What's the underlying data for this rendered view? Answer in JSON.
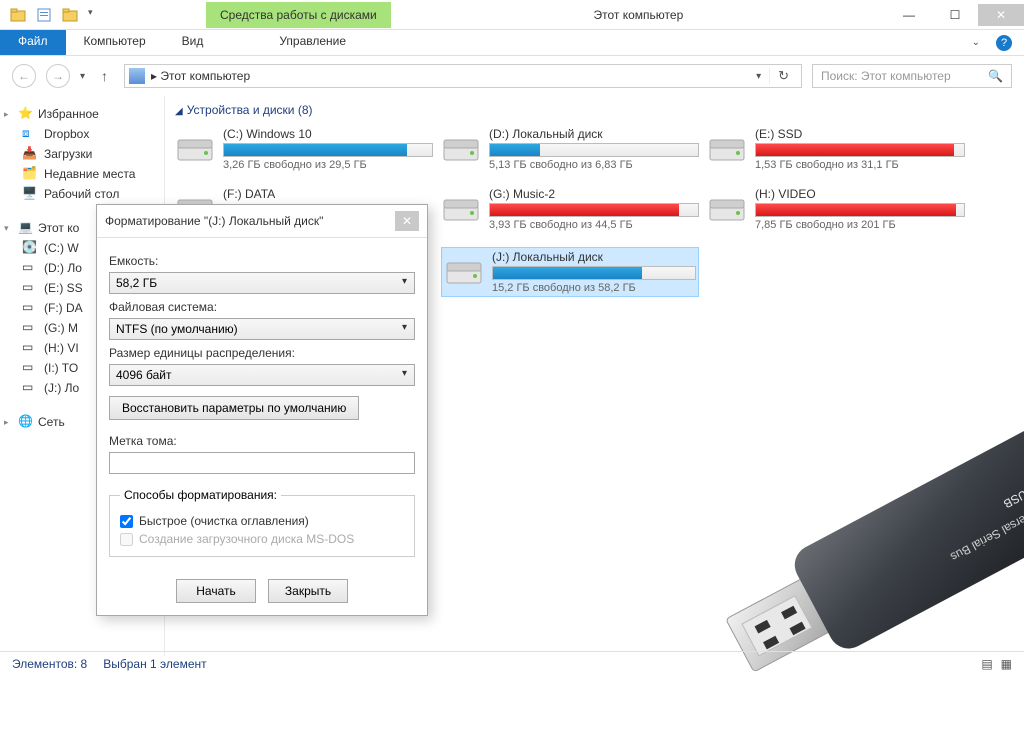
{
  "titlebar": {
    "context_tab": "Средства работы с дисками",
    "title": "Этот компьютер"
  },
  "ribbon": {
    "file": "Файл",
    "computer": "Компьютер",
    "view": "Вид",
    "manage": "Управление"
  },
  "nav": {
    "address": "Этот компьютер",
    "search_placeholder": "Поиск: Этот компьютер"
  },
  "sidebar": {
    "favorites": {
      "title": "Избранное",
      "items": [
        "Dropbox",
        "Загрузки",
        "Недавние места",
        "Рабочий стол"
      ]
    },
    "pc": {
      "title": "Этот ко",
      "items": [
        "(C:) W",
        "(D:) Ло",
        "(E:) SS",
        "(F:) DA",
        "(G:) M",
        "(H:) VI",
        "(I:) TO",
        "(J:) Ло"
      ]
    },
    "network": {
      "title": "Сеть"
    }
  },
  "main": {
    "section": "Устройства и диски (8)",
    "drives": [
      {
        "name": "(C:) Windows 10",
        "free": "3,26 ГБ свободно из 29,5 ГБ",
        "color": "blue",
        "pct": 88,
        "selected": false
      },
      {
        "name": "(D:) Локальный диск",
        "free": "5,13 ГБ свободно из 6,83 ГБ",
        "color": "blue",
        "pct": 24,
        "selected": false
      },
      {
        "name": "(E:) SSD",
        "free": "1,53 ГБ свободно из 31,1 ГБ",
        "color": "red",
        "pct": 95,
        "selected": false
      },
      {
        "name": "(F:) DATA",
        "free": "",
        "color": "",
        "pct": 0,
        "selected": false,
        "hidden": true
      },
      {
        "name": "(G:) Music-2",
        "free": "3,93 ГБ свободно из 44,5 ГБ",
        "color": "red",
        "pct": 91,
        "selected": false
      },
      {
        "name": "(H:) VIDEO",
        "free": "7,85 ГБ свободно из 201 ГБ",
        "color": "red",
        "pct": 96,
        "selected": false
      },
      {
        "name": "",
        "free": "",
        "color": "",
        "pct": 0,
        "selected": false,
        "hidden": true,
        "ghost": true
      },
      {
        "name": "(J:) Локальный диск",
        "free": "15,2 ГБ свободно из 58,2 ГБ",
        "color": "blue",
        "pct": 74,
        "selected": true
      }
    ]
  },
  "dialog": {
    "title": "Форматирование \"(J:) Локальный диск\"",
    "capacity_label": "Емкость:",
    "capacity_value": "58,2 ГБ",
    "fs_label": "Файловая система:",
    "fs_value": "NTFS (по умолчанию)",
    "alloc_label": "Размер единицы распределения:",
    "alloc_value": "4096 байт",
    "restore_defaults": "Восстановить параметры по умолчанию",
    "volume_label": "Метка тома:",
    "volume_value": "",
    "group_label": "Способы форматирования:",
    "quick_label": "Быстрое (очистка оглавления)",
    "msdos_label": "Создание загрузочного диска MS-DOS",
    "start": "Начать",
    "close": "Закрыть"
  },
  "status": {
    "count": "Элементов: 8",
    "selection": "Выбран 1 элемент"
  },
  "usb": {
    "line1": "USB",
    "line2": "Universal Serial Bus"
  }
}
